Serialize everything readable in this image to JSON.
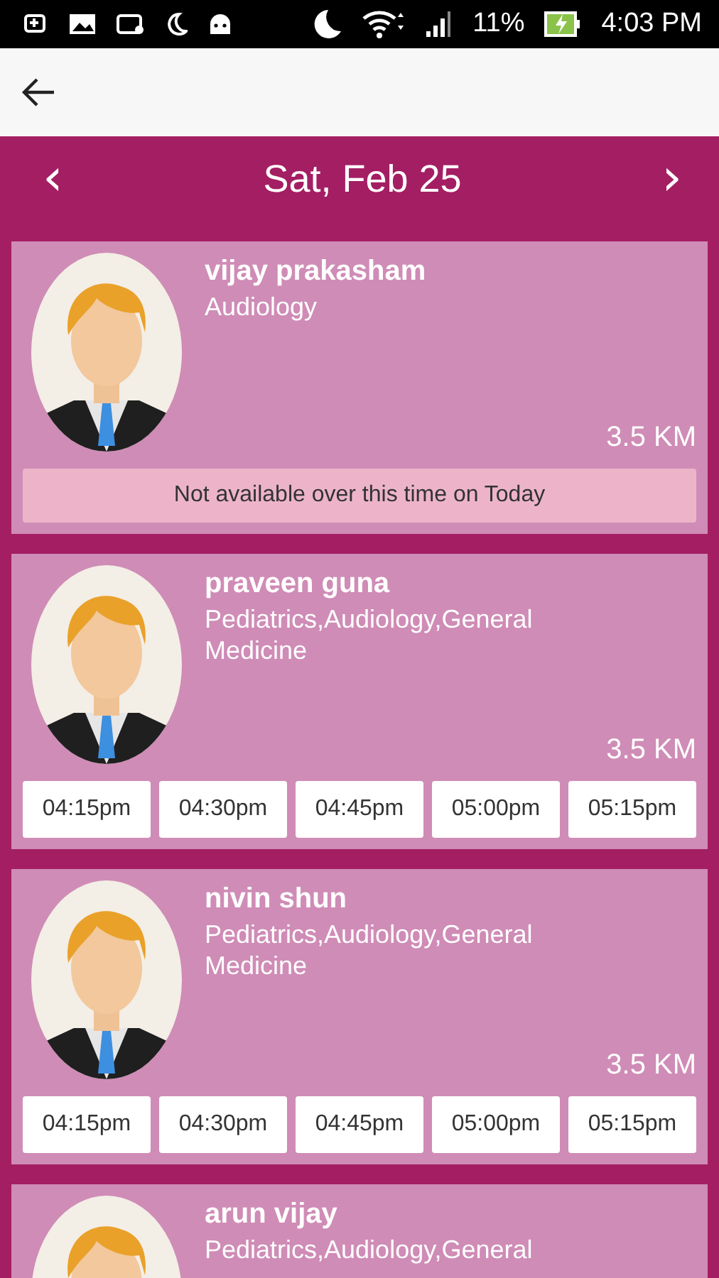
{
  "status_bar": {
    "battery": "11%",
    "time": "4:03 PM"
  },
  "date_header": {
    "prev": "‹",
    "title": "Sat, Feb 25",
    "next": "›"
  },
  "doctors": [
    {
      "name": "vijay prakasham",
      "specialty": "Audiology",
      "distance": "3.5 KM",
      "kind": "note",
      "note": "Not available over this time on Today"
    },
    {
      "name": "praveen guna",
      "specialty": "Pediatrics,Audiology,General Medicine",
      "distance": "3.5 KM",
      "kind": "slots",
      "slots": [
        "04:15pm",
        "04:30pm",
        "04:45pm",
        "05:00pm",
        "05:15pm"
      ]
    },
    {
      "name": "nivin shun",
      "specialty": "Pediatrics,Audiology,General Medicine",
      "distance": "3.5 KM",
      "kind": "slots",
      "slots": [
        "04:15pm",
        "04:30pm",
        "04:45pm",
        "05:00pm",
        "05:15pm"
      ]
    },
    {
      "name": "arun vijay",
      "specialty": "Pediatrics,Audiology,General",
      "kind": "partial"
    }
  ]
}
